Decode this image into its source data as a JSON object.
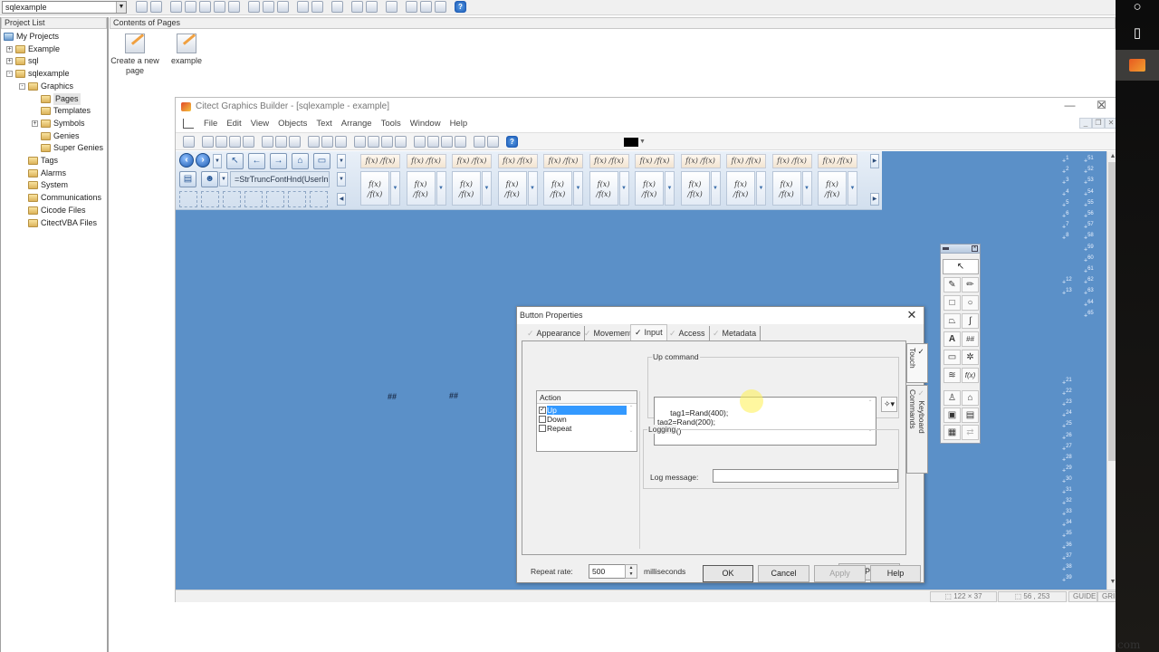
{
  "top_toolbar": {
    "project_selector": "sqlexample"
  },
  "project_list": {
    "header": "Project List",
    "items": [
      {
        "label": "My Projects",
        "level": 0,
        "expander": ""
      },
      {
        "label": "Example",
        "level": 1,
        "expander": "+"
      },
      {
        "label": "sql",
        "level": 1,
        "expander": "+"
      },
      {
        "label": "sqlexample",
        "level": 1,
        "expander": "-"
      },
      {
        "label": "Graphics",
        "level": 2,
        "expander": "-"
      },
      {
        "label": "Pages",
        "level": 3,
        "expander": "",
        "selected": true
      },
      {
        "label": "Templates",
        "level": 3,
        "expander": ""
      },
      {
        "label": "Symbols",
        "level": 3,
        "expander": "+"
      },
      {
        "label": "Genies",
        "level": 3,
        "expander": ""
      },
      {
        "label": "Super Genies",
        "level": 3,
        "expander": ""
      },
      {
        "label": "Tags",
        "level": 2,
        "expander": ""
      },
      {
        "label": "Alarms",
        "level": 2,
        "expander": ""
      },
      {
        "label": "System",
        "level": 2,
        "expander": ""
      },
      {
        "label": "Communications",
        "level": 2,
        "expander": ""
      },
      {
        "label": "Cicode Files",
        "level": 2,
        "expander": ""
      },
      {
        "label": "CitectVBA Files",
        "level": 2,
        "expander": ""
      }
    ]
  },
  "contents": {
    "header": "Contents of Pages",
    "items": [
      {
        "label_line1": "Create a new",
        "label_line2": "page"
      },
      {
        "label_line1": "example",
        "label_line2": ""
      }
    ]
  },
  "graphics_builder": {
    "title": "Citect Graphics Builder - [sqlexample - example]",
    "window_controls": {
      "minimize": "—",
      "maximize": "☐",
      "close": "✕"
    },
    "mdi_controls": {
      "minimize": "_",
      "restore": "❐",
      "close": "✕"
    },
    "menu": [
      "File",
      "Edit",
      "View",
      "Objects",
      "Text",
      "Arrange",
      "Tools",
      "Window",
      "Help"
    ],
    "fill_color": "#000000",
    "expression_field": "=StrTruncFontHnd(UserIn",
    "fx_small_label": "f(x) ∕f(x)",
    "fx_big_top": "f(x)",
    "fx_big_bottom": "∕f(x)",
    "canvas_color": "#5b90c8",
    "canvas_numeric_placeholders": [
      "##",
      "##"
    ],
    "tag_labels_col1": [
      "1",
      "2",
      "3",
      "4",
      "5",
      "6",
      "7",
      "8",
      "",
      "",
      "",
      "12",
      "13"
    ],
    "tag_labels_col2": [
      "51",
      "52",
      "53",
      "54",
      "55",
      "56",
      "57",
      "58",
      "59",
      "60",
      "61",
      "62",
      "63",
      "64",
      "65"
    ],
    "tag_labels_col3": [
      "21",
      "22",
      "23",
      "24",
      "25",
      "26",
      "27",
      "28",
      "29",
      "30",
      "31",
      "32",
      "33",
      "34",
      "35",
      "36",
      "37",
      "38",
      "39"
    ],
    "status": {
      "size": "122 × 37",
      "position": "56 , 253",
      "guide": "GUIDE",
      "grid": "GRID"
    }
  },
  "tools_palette": {
    "tools": [
      "pointer",
      "freehand-pen",
      "pen",
      "rectangle",
      "ellipse",
      "polygon",
      "pipe",
      "text",
      "number",
      "button",
      "symbol-set",
      "trend",
      "cicode-object",
      "symbol",
      "genie",
      "group-image",
      "cicode-chart",
      "table",
      "disabled-tool"
    ]
  },
  "dialog": {
    "title": "Button Properties",
    "close": "✕",
    "tabs": [
      {
        "label": "Appearance",
        "active": false
      },
      {
        "label": "Movement",
        "active": false
      },
      {
        "label": "Input",
        "active": true
      },
      {
        "label": "Access",
        "active": false
      },
      {
        "label": "Metadata",
        "active": false
      }
    ],
    "side_tabs": [
      {
        "label": "Touch",
        "active": true
      },
      {
        "label": "Keyboard Commands",
        "active": false
      }
    ],
    "check_mark": "✓",
    "action": {
      "header": "Action",
      "items": [
        {
          "label": "Up",
          "checked": true,
          "selected": true
        },
        {
          "label": "Down",
          "checked": false,
          "selected": false
        },
        {
          "label": "Repeat",
          "checked": false,
          "selected": false
        }
      ]
    },
    "up_command": {
      "label": "Up command",
      "value": "tag1=Rand(400);\ntag2=Rand(200);\ninsert()"
    },
    "logging": {
      "label": "Logging",
      "log_message_label": "Log message:",
      "log_message_value": ""
    },
    "repeat_rate": {
      "label": "Repeat rate:",
      "value": "500",
      "unit": "milliseconds"
    },
    "buttons": {
      "clear_property": "Clear Property",
      "ok": "OK",
      "cancel": "Cancel",
      "apply": "Apply",
      "help": "Help"
    }
  },
  "taskbar": {
    "watermark": "com"
  }
}
